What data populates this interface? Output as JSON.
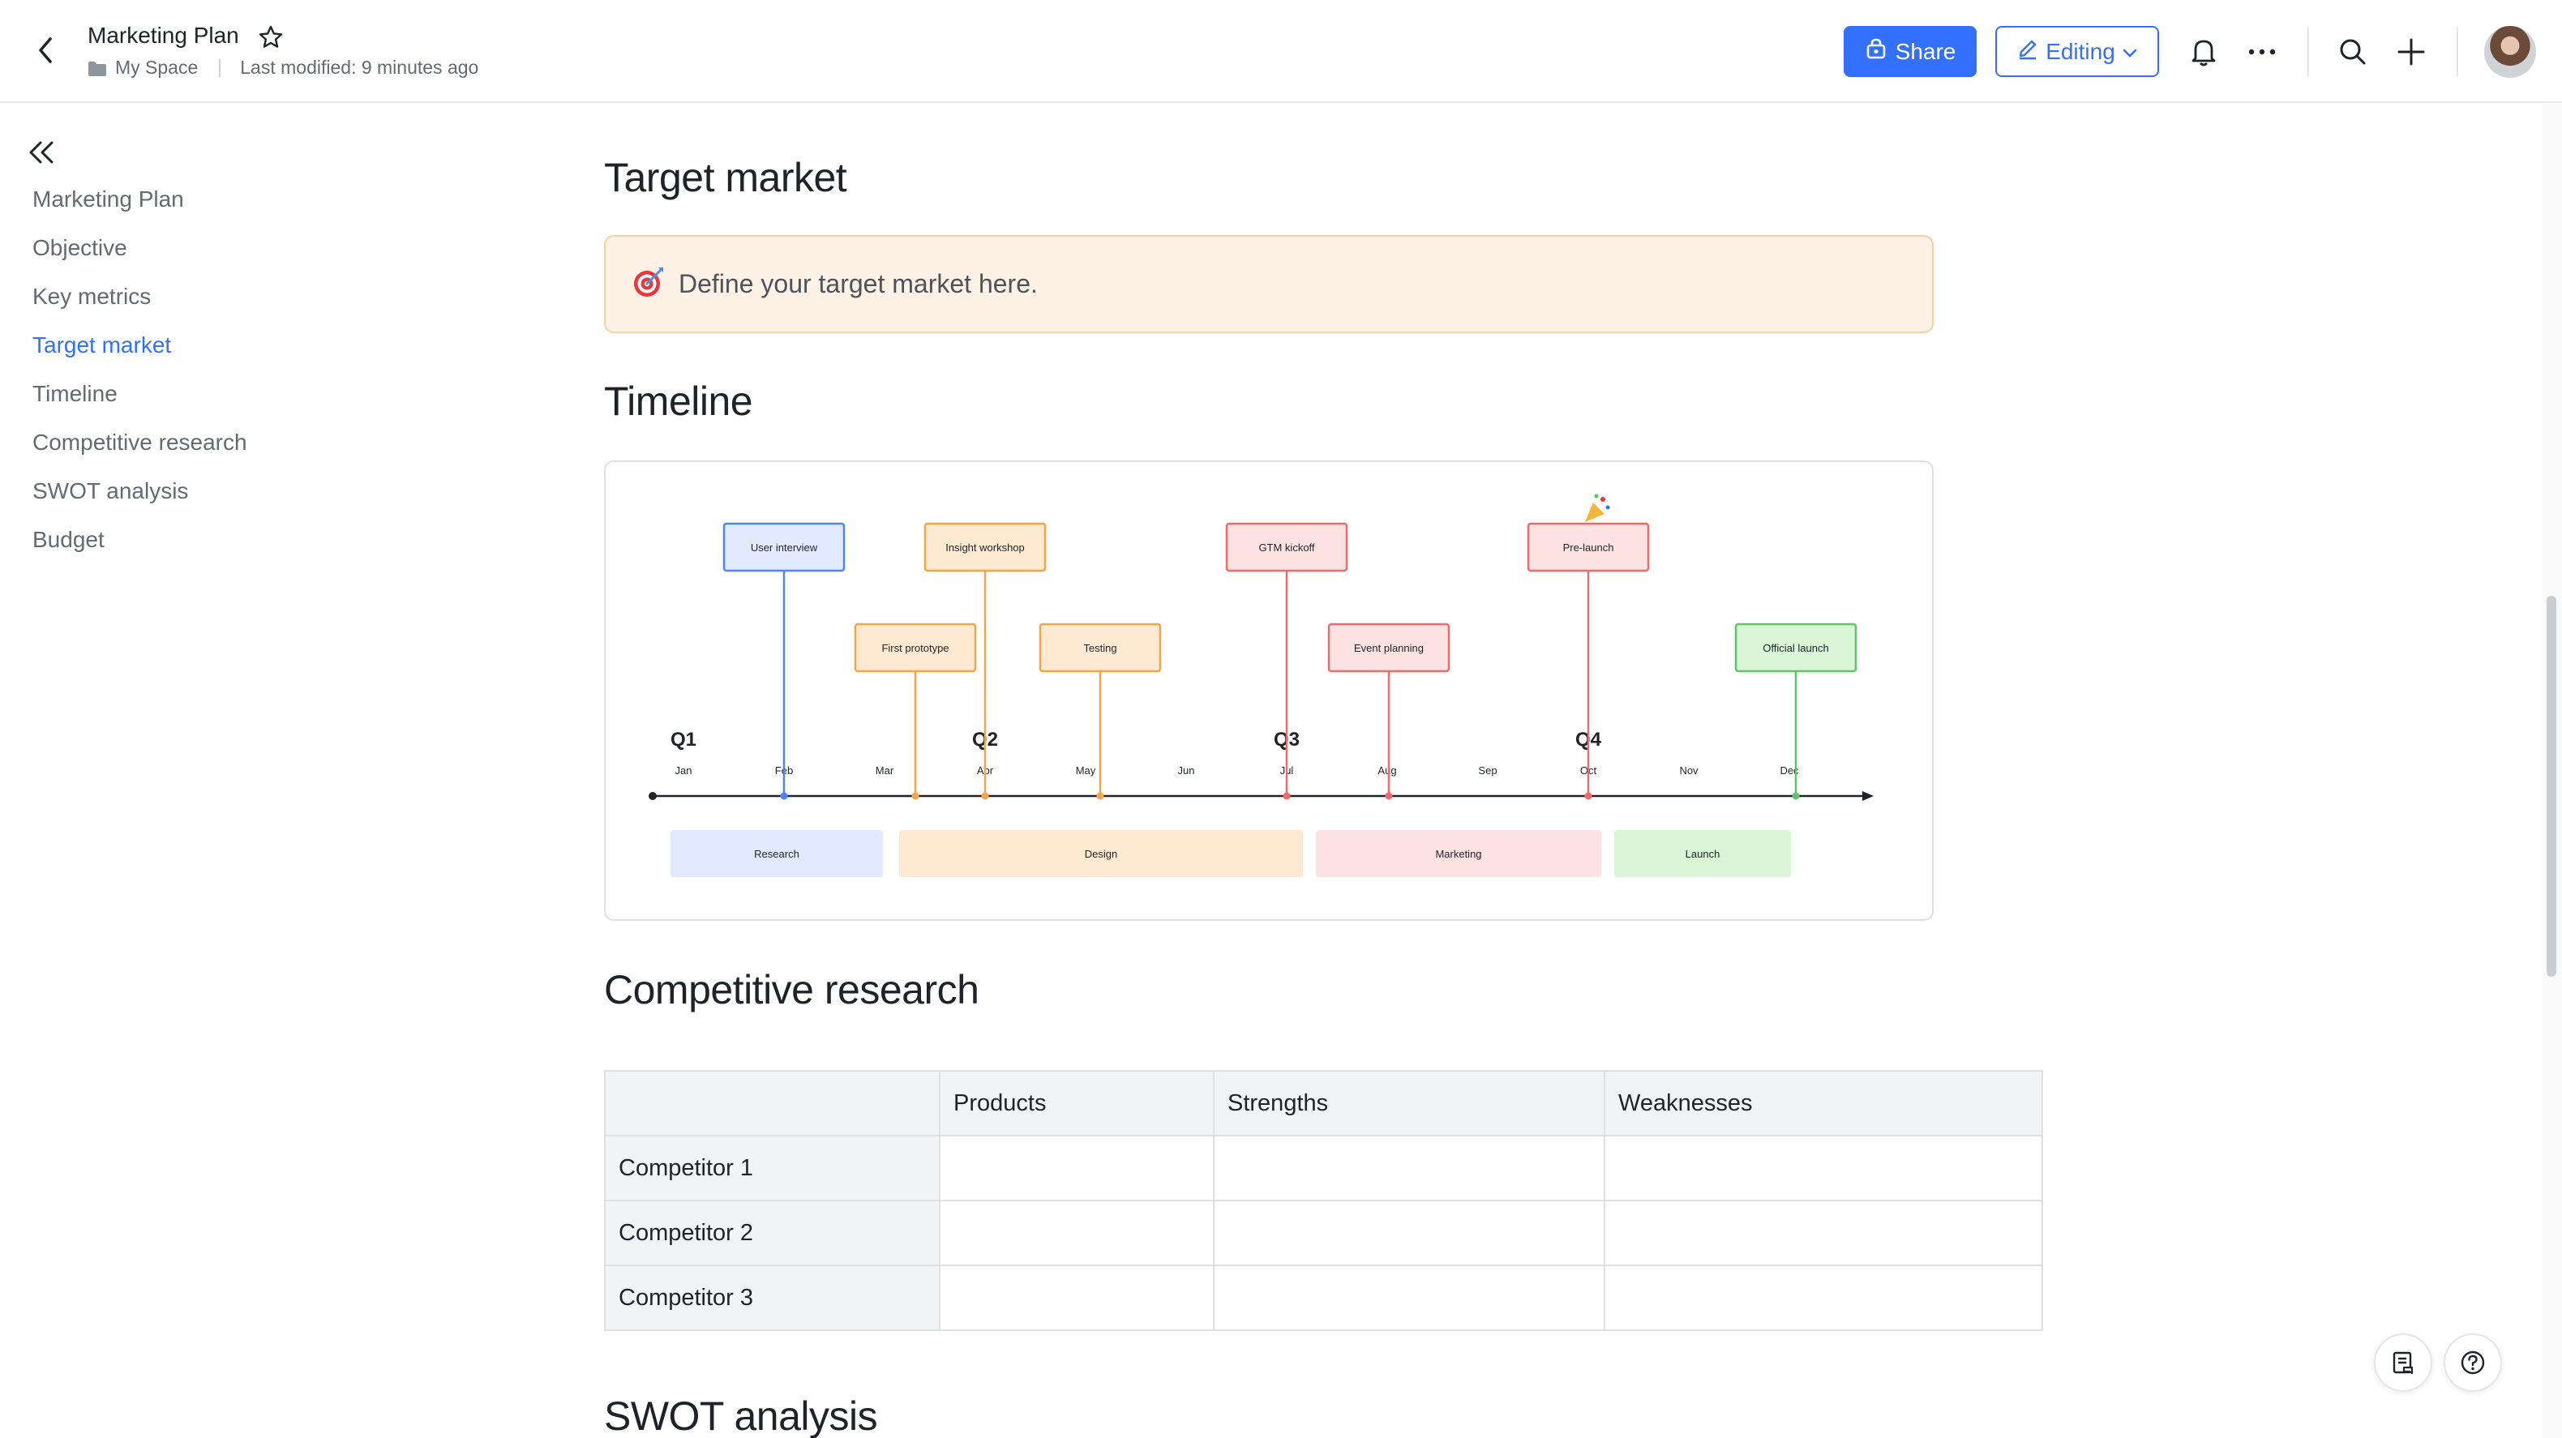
{
  "header": {
    "title": "Marketing Plan",
    "breadcrumb_space": "My Space",
    "last_modified": "Last modified: 9 minutes ago",
    "share_label": "Share",
    "editing_label": "Editing"
  },
  "outline": {
    "items": [
      {
        "label": "Marketing Plan",
        "active": false
      },
      {
        "label": "Objective",
        "active": false
      },
      {
        "label": "Key metrics",
        "active": false
      },
      {
        "label": "Target market",
        "active": true
      },
      {
        "label": "Timeline",
        "active": false
      },
      {
        "label": "Competitive research",
        "active": false
      },
      {
        "label": "SWOT analysis",
        "active": false
      },
      {
        "label": "Budget",
        "active": false
      }
    ]
  },
  "sections": {
    "target_market": {
      "heading": "Target market",
      "callout_text": "Define your target market here."
    },
    "timeline": {
      "heading": "Timeline",
      "quarters": [
        "Q1",
        "Q2",
        "Q3",
        "Q4"
      ],
      "months": [
        "Jan",
        "Feb",
        "Mar",
        "Apr",
        "May",
        "Jun",
        "Jul",
        "Aug",
        "Sep",
        "Oct",
        "Nov",
        "Dec"
      ],
      "milestones": [
        {
          "label": "User interview",
          "month": "Feb",
          "row": "upper",
          "color": "#4e83fd"
        },
        {
          "label": "First prototype",
          "month": "Mar",
          "row": "lower",
          "color": "#f5a543"
        },
        {
          "label": "Insight workshop",
          "month": "Apr",
          "row": "upper",
          "color": "#f5a543"
        },
        {
          "label": "Testing",
          "month": "May",
          "row": "lower",
          "color": "#f5a543"
        },
        {
          "label": "GTM kickoff",
          "month": "Jul",
          "row": "upper",
          "color": "#ef6a6a"
        },
        {
          "label": "Event planning",
          "month": "Aug",
          "row": "lower",
          "color": "#ef6a6a"
        },
        {
          "label": "Pre-launch",
          "month": "Oct",
          "row": "upper",
          "color": "#ef6a6a"
        },
        {
          "label": "Official launch",
          "month": "Dec",
          "row": "lower",
          "color": "#5ec36a"
        }
      ],
      "phases": [
        {
          "label": "Research",
          "color": "#e1eaff"
        },
        {
          "label": "Design",
          "color": "#feead2"
        },
        {
          "label": "Marketing",
          "color": "#fde2e2"
        },
        {
          "label": "Launch",
          "color": "#d9f5d6"
        }
      ]
    },
    "competitive_research": {
      "heading": "Competitive research",
      "columns": [
        "",
        "Products",
        "Strengths",
        "Weaknesses"
      ],
      "rows": [
        [
          "Competitor 1",
          "",
          "",
          ""
        ],
        [
          "Competitor 2",
          "",
          "",
          ""
        ],
        [
          "Competitor 3",
          "",
          "",
          ""
        ]
      ]
    },
    "swot": {
      "heading": "SWOT analysis"
    }
  },
  "icons": {
    "back": "chevron-left-icon",
    "favorite": "star-icon",
    "folder": "folder-icon",
    "share": "lock-share-icon",
    "edit": "pencil-icon",
    "notifications": "bell-icon",
    "more": "more-horizontal-icon",
    "search": "search-icon",
    "add": "plus-icon",
    "collapse_outline": "double-chevron-left-icon",
    "target": "target-emoji-icon",
    "party": "party-popper-icon",
    "comments": "comment-list-icon",
    "help": "help-icon"
  },
  "colors": {
    "accent": "#3370ff",
    "callout_bg": "#fef1e6",
    "callout_border": "#f8cfa5"
  }
}
